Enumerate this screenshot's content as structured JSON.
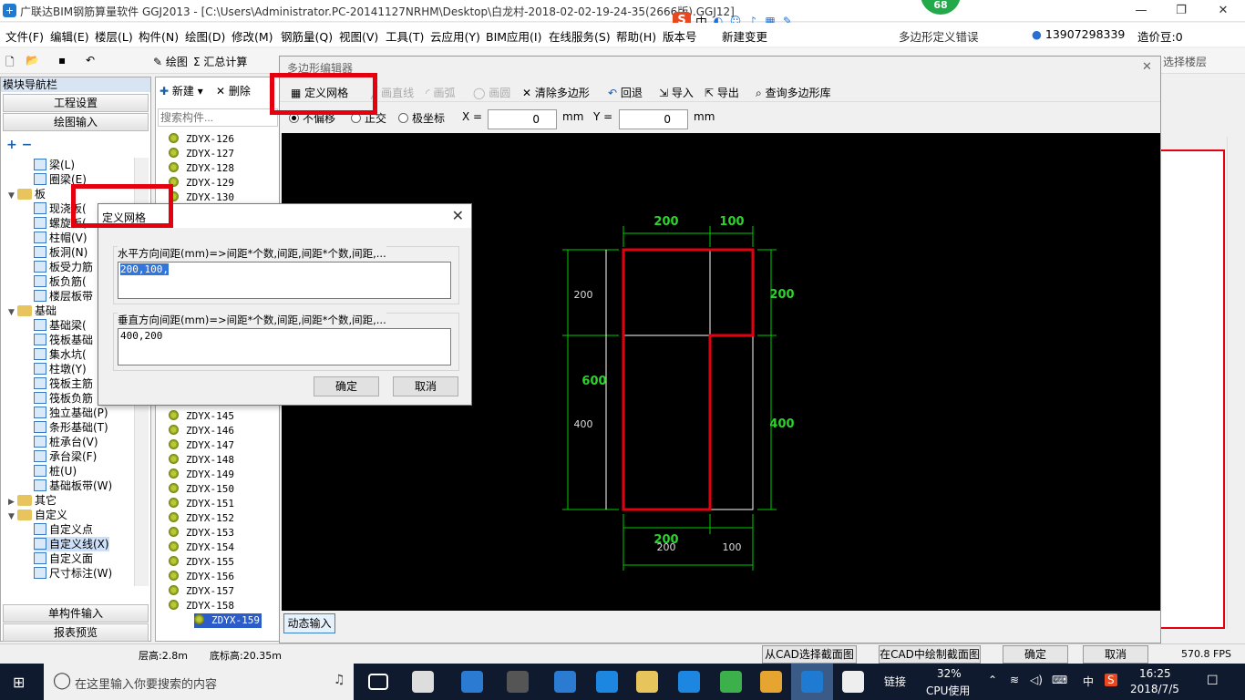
{
  "window": {
    "title": "广联达BIM钢筋算量软件 GGJ2013 - [C:\\Users\\Administrator.PC-20141127NRHM\\Desktop\\白龙村-2018-02-02-19-24-35(2666版).GGJ12]",
    "badge": "68",
    "error_label": "多边形定义错误"
  },
  "menu": {
    "items": [
      "文件(F)",
      "编辑(E)",
      "楼层(L)",
      "构件(N)",
      "绘图(D)",
      "修改(M)",
      "钢筋量(Q)",
      "视图(V)",
      "工具(T)",
      "云应用(Y)",
      "BIM应用(I)",
      "在线服务(S)",
      "帮助(H)",
      "版本号",
      "新建变更"
    ],
    "user": "13907298339",
    "cost_bean": "造价豆:0",
    "ime_label": "中"
  },
  "toolbar": {
    "draw": "绘图",
    "sum": "汇总计算",
    "select_floor": "选择楼层"
  },
  "nav": {
    "title": "模块导航栏",
    "engineering": "工程设置",
    "draw_input": "绘图输入",
    "single_input": "单构件输入",
    "report": "报表预览",
    "tree": [
      "梁(L)",
      "圈梁(E)",
      "板",
      "现浇板(",
      "螺旋板(",
      "柱帽(V)",
      "板洞(N)",
      "板受力筋",
      "板负筋(",
      "楼层板带",
      "基础",
      "基础梁(",
      "筏板基础",
      "集水坑(",
      "柱墩(Y)",
      "筏板主筋",
      "筏板负筋",
      "独立基础(P)",
      "条形基础(T)",
      "桩承台(V)",
      "承台梁(F)",
      "桩(U)",
      "基础板带(W)",
      "其它",
      "自定义",
      "自定义点",
      "自定义线(X)",
      "自定义面",
      "尺寸标注(W)"
    ]
  },
  "components": {
    "new": "新建",
    "delete": "删除",
    "search_placeholder": "搜索构件...",
    "top": [
      "ZDYX-126",
      "ZDYX-127",
      "ZDYX-128",
      "ZDYX-129",
      "ZDYX-130"
    ],
    "bottom": [
      "ZDYX-145",
      "ZDYX-146",
      "ZDYX-147",
      "ZDYX-148",
      "ZDYX-149",
      "ZDYX-150",
      "ZDYX-151",
      "ZDYX-152",
      "ZDYX-153",
      "ZDYX-154",
      "ZDYX-155",
      "ZDYX-156",
      "ZDYX-157",
      "ZDYX-158",
      "ZDYX-159"
    ]
  },
  "editor": {
    "title": "多边形编辑器",
    "define_grid": "定义网格",
    "line": "画直线",
    "arc": "画弧",
    "circle": "画圆",
    "clear": "清除多边形",
    "undo": "回退",
    "import": "导入",
    "export": "导出",
    "query": "查询多边形库",
    "no_offset": "不偏移",
    "ortho": "正交",
    "polar": "极坐标",
    "x_label": "X =",
    "x_val": "0",
    "y_label": "Y =",
    "y_val": "0",
    "unit": "mm",
    "dynamic_input": "动态输入",
    "from_cad": "从CAD选择截面图",
    "draw_cad": "在CAD中绘制截面图",
    "ok": "确定",
    "cancel": "取消"
  },
  "dims": {
    "top": [
      "200",
      "100"
    ],
    "left_total": "600",
    "left": [
      "200",
      "400"
    ],
    "right": [
      "200",
      "400"
    ],
    "bottom_big": "200",
    "bottom": [
      "200",
      "100"
    ]
  },
  "dialog": {
    "title": "定义网格",
    "h_label": "水平方向间距(mm)=>间距*个数,间距,间距*个数,间距,...",
    "h_val": "200,100,",
    "v_label": "垂直方向间距(mm)=>间距*个数,间距,间距*个数,间距,...",
    "v_val": "400,200",
    "ok": "确定",
    "cancel": "取消"
  },
  "status": {
    "floor_h": "层高:2.8m",
    "base_h": "底标高:20.35m",
    "fps": "570.8 FPS"
  },
  "taskbar": {
    "search": "在这里输入你要搜索的内容",
    "link": "链接",
    "cpu": "32%",
    "cpu_label": "CPU使用",
    "ime": "中",
    "time": "16:25",
    "date": "2018/7/5"
  }
}
